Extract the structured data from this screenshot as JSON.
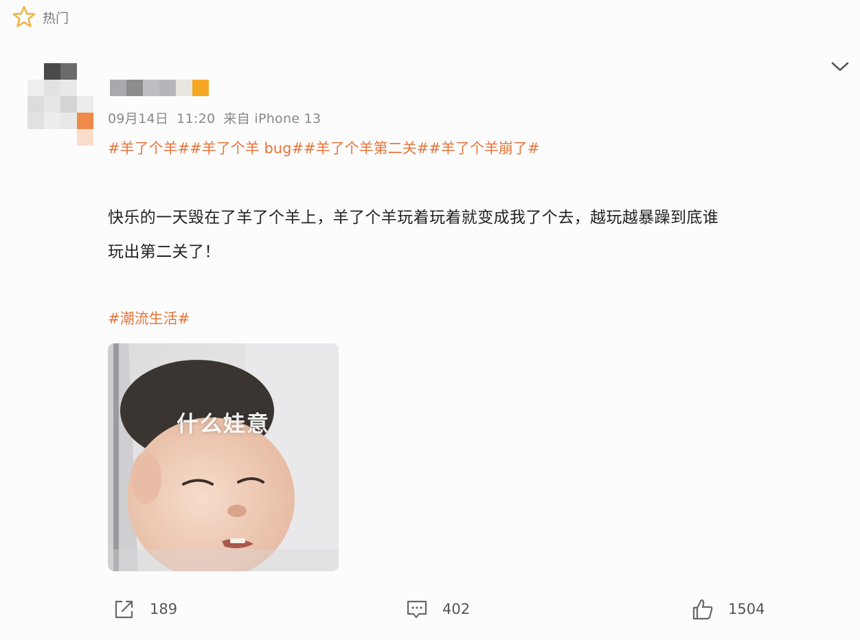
{
  "header": {
    "label": "热门",
    "icon": "star-icon"
  },
  "post": {
    "meta": {
      "date": "09月14日",
      "time": "11:20",
      "source": "来自 iPhone 13"
    },
    "hashtags": [
      "#羊了个羊#",
      "#羊了个羊 bug#",
      "#羊了个羊第二关#",
      "#羊了个羊崩了#"
    ],
    "text_line1": "快乐的一天毁在了羊了个羊上，羊了个羊玩着玩着就变成我了个去，越玩越暴躁到底谁",
    "text_line2": "玩出第二关了！",
    "topic": "#潮流生活#",
    "image_caption": "什么娃意"
  },
  "actions": {
    "repost": {
      "icon": "repost-icon",
      "count": "189"
    },
    "comment": {
      "icon": "comment-icon",
      "count": "402"
    },
    "like": {
      "icon": "thumbs-up-icon",
      "count": "1504"
    }
  },
  "colors": {
    "accent": "#e8743a",
    "star": "#f2b441",
    "meta": "#888888"
  }
}
